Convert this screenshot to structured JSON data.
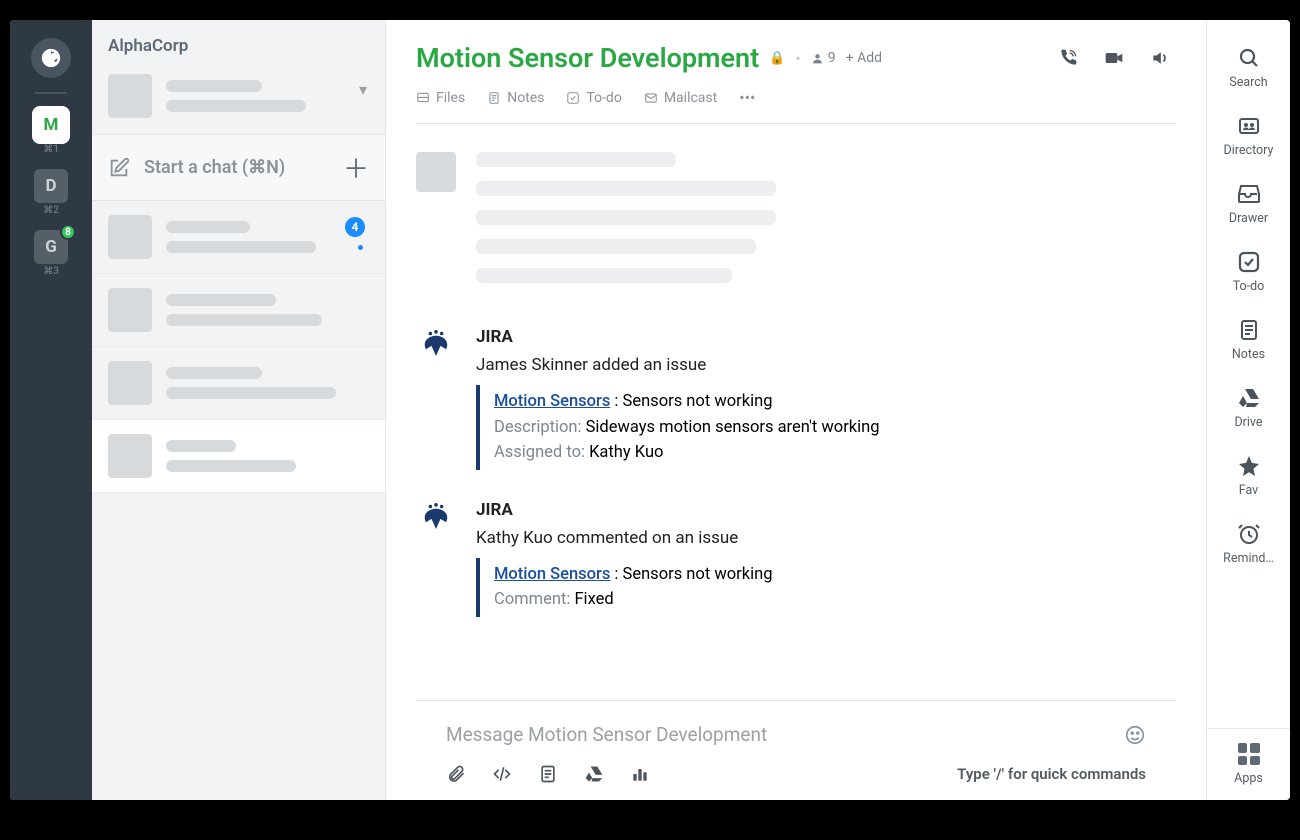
{
  "rail": {
    "workspaces": [
      {
        "letter": "M",
        "hotkey": "⌘1",
        "active": true,
        "badge": null
      },
      {
        "letter": "D",
        "hotkey": "⌘2",
        "active": false,
        "badge": null
      },
      {
        "letter": "G",
        "hotkey": "⌘3",
        "active": false,
        "badge": "8"
      }
    ]
  },
  "sidebar": {
    "org": "AlphaCorp",
    "start_chat": "Start a chat (⌘N)",
    "items": [
      {
        "badge": "4",
        "dot": true
      },
      {
        "badge": null,
        "dot": false
      },
      {
        "badge": null,
        "dot": false
      },
      {
        "badge": null,
        "dot": false,
        "active": true
      }
    ]
  },
  "header": {
    "title": "Motion Sensor Development",
    "people_count": "9",
    "add_label": "+ Add",
    "tabs": {
      "files": "Files",
      "notes": "Notes",
      "todo": "To-do",
      "mailcast": "Mailcast"
    }
  },
  "feed": {
    "jira1": {
      "app": "JIRA",
      "line": "James Skinner added an issue",
      "link": "Motion Sensors",
      "link_suffix": " : Sensors not working",
      "desc_label": "Description: ",
      "desc_val": "Sideways motion sensors aren't working",
      "assigned_label": "Assigned to: ",
      "assigned_val": "Kathy Kuo"
    },
    "jira2": {
      "app": "JIRA",
      "line": "Kathy Kuo commented on an issue",
      "link": "Motion Sensors",
      "link_suffix": " : Sensors not working",
      "comment_label": "Comment: ",
      "comment_val": "Fixed"
    }
  },
  "composer": {
    "placeholder": "Message Motion Sensor Development",
    "hint": "Type '/' for quick commands"
  },
  "rrail": {
    "search": "Search",
    "directory": "Directory",
    "drawer": "Drawer",
    "todo": "To-do",
    "notes": "Notes",
    "drive": "Drive",
    "fav": "Fav",
    "remind": "Remind…",
    "apps": "Apps"
  }
}
